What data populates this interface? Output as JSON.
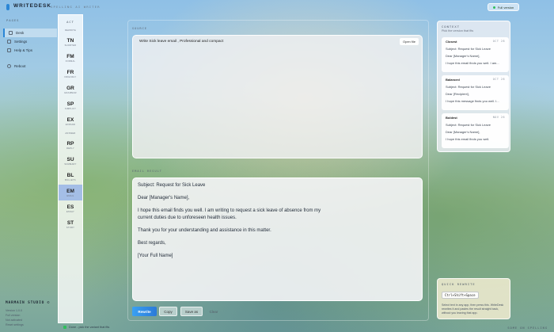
{
  "app": {
    "brand": "WRITEDESK",
    "tagline": "SPELLING AI WRITER",
    "full_version": "Full version"
  },
  "sidebar": {
    "heading": "PAGES",
    "items": [
      {
        "label": "Desk",
        "active": true
      },
      {
        "label": "Settings",
        "active": false
      },
      {
        "label": "Help & Tips",
        "active": false
      },
      {
        "label": "Reboot",
        "active": false
      }
    ],
    "studio": "MARMAIN STUDIO ©",
    "version": "Version 1.0.0",
    "edition": "Full version",
    "license": "Not activated",
    "reset": "Reset settings"
  },
  "acts": {
    "heading": "ACT",
    "items": [
      {
        "abbr": "",
        "name": "REWRITE"
      },
      {
        "abbr": "TN",
        "name": "SHORTER"
      },
      {
        "abbr": "FM",
        "name": "FORMAL"
      },
      {
        "abbr": "FR",
        "name": "FRIENDLY"
      },
      {
        "abbr": "GR",
        "name": "GRAMMAR"
      },
      {
        "abbr": "SP",
        "name": "SIMPLIFY"
      },
      {
        "abbr": "EX",
        "name": "EXPAND"
      },
      {
        "abbr": "",
        "name": "ANSWER"
      },
      {
        "abbr": "RP",
        "name": "REPLY"
      },
      {
        "abbr": "SU",
        "name": "SUMMARY"
      },
      {
        "abbr": "BL",
        "name": "BULLETS"
      },
      {
        "abbr": "EM",
        "name": "EMAIL"
      },
      {
        "abbr": "ES",
        "name": "ESSAY"
      },
      {
        "abbr": "ST",
        "name": "STORY"
      }
    ],
    "active_index": 11
  },
  "input": {
    "label": "SOURCE",
    "text": "Write Sick leave email , Professional and compact",
    "open_file": "Open file"
  },
  "output": {
    "label": "EMAIL RESULT",
    "paragraphs": [
      "Subject: Request for Sick Leave",
      "Dear [Manager's Name],",
      "I hope this email finds you well. I am writing to request a sick leave of absence from my",
      "current duties due to unforeseen health issues.",
      "Thank you for your understanding and assistance in this matter.",
      "Best regards,",
      "[Your Full Name]"
    ]
  },
  "actions": {
    "rewrite": "Rewrite",
    "copy": "Copy",
    "save_as": "Save as",
    "clear": "Clear"
  },
  "status": {
    "text": "Done - pick the variant that fits"
  },
  "footer": {
    "right": "SOME ON SPELLING"
  },
  "variants": {
    "heading": "CONTEXT",
    "subheading": "Pick the version that fits",
    "cards": [
      {
        "title": "Closest",
        "date": "OCT 28",
        "lines": [
          "Subject: Request for Sick Leave",
          "Dear [Manager's Name],",
          "I hope this email finds you well. I am..."
        ]
      },
      {
        "title": "Balanced",
        "date": "OCT 28",
        "lines": [
          "Subject: Request for Sick Leave",
          "Dear [Recipient],",
          "I hope this message finds you well. I..."
        ]
      },
      {
        "title": "Boldest",
        "date": "NOV 26",
        "lines": [
          "Subject: Request for Sick Leave",
          "Dear [Manager's Name],",
          "I hope this email finds you well."
        ]
      }
    ]
  },
  "quick": {
    "heading": "QUICK REWRITE",
    "shortcut": "Ctrl+Shift+Space",
    "description": "Select text in any app, then press this. WriteDesk rewrites it and pastes the result straight back, without you leaving that app."
  },
  "colors": {
    "accent": "#2b86d6",
    "active_act": "#7096eb",
    "status_ok": "#2fbf5b"
  }
}
